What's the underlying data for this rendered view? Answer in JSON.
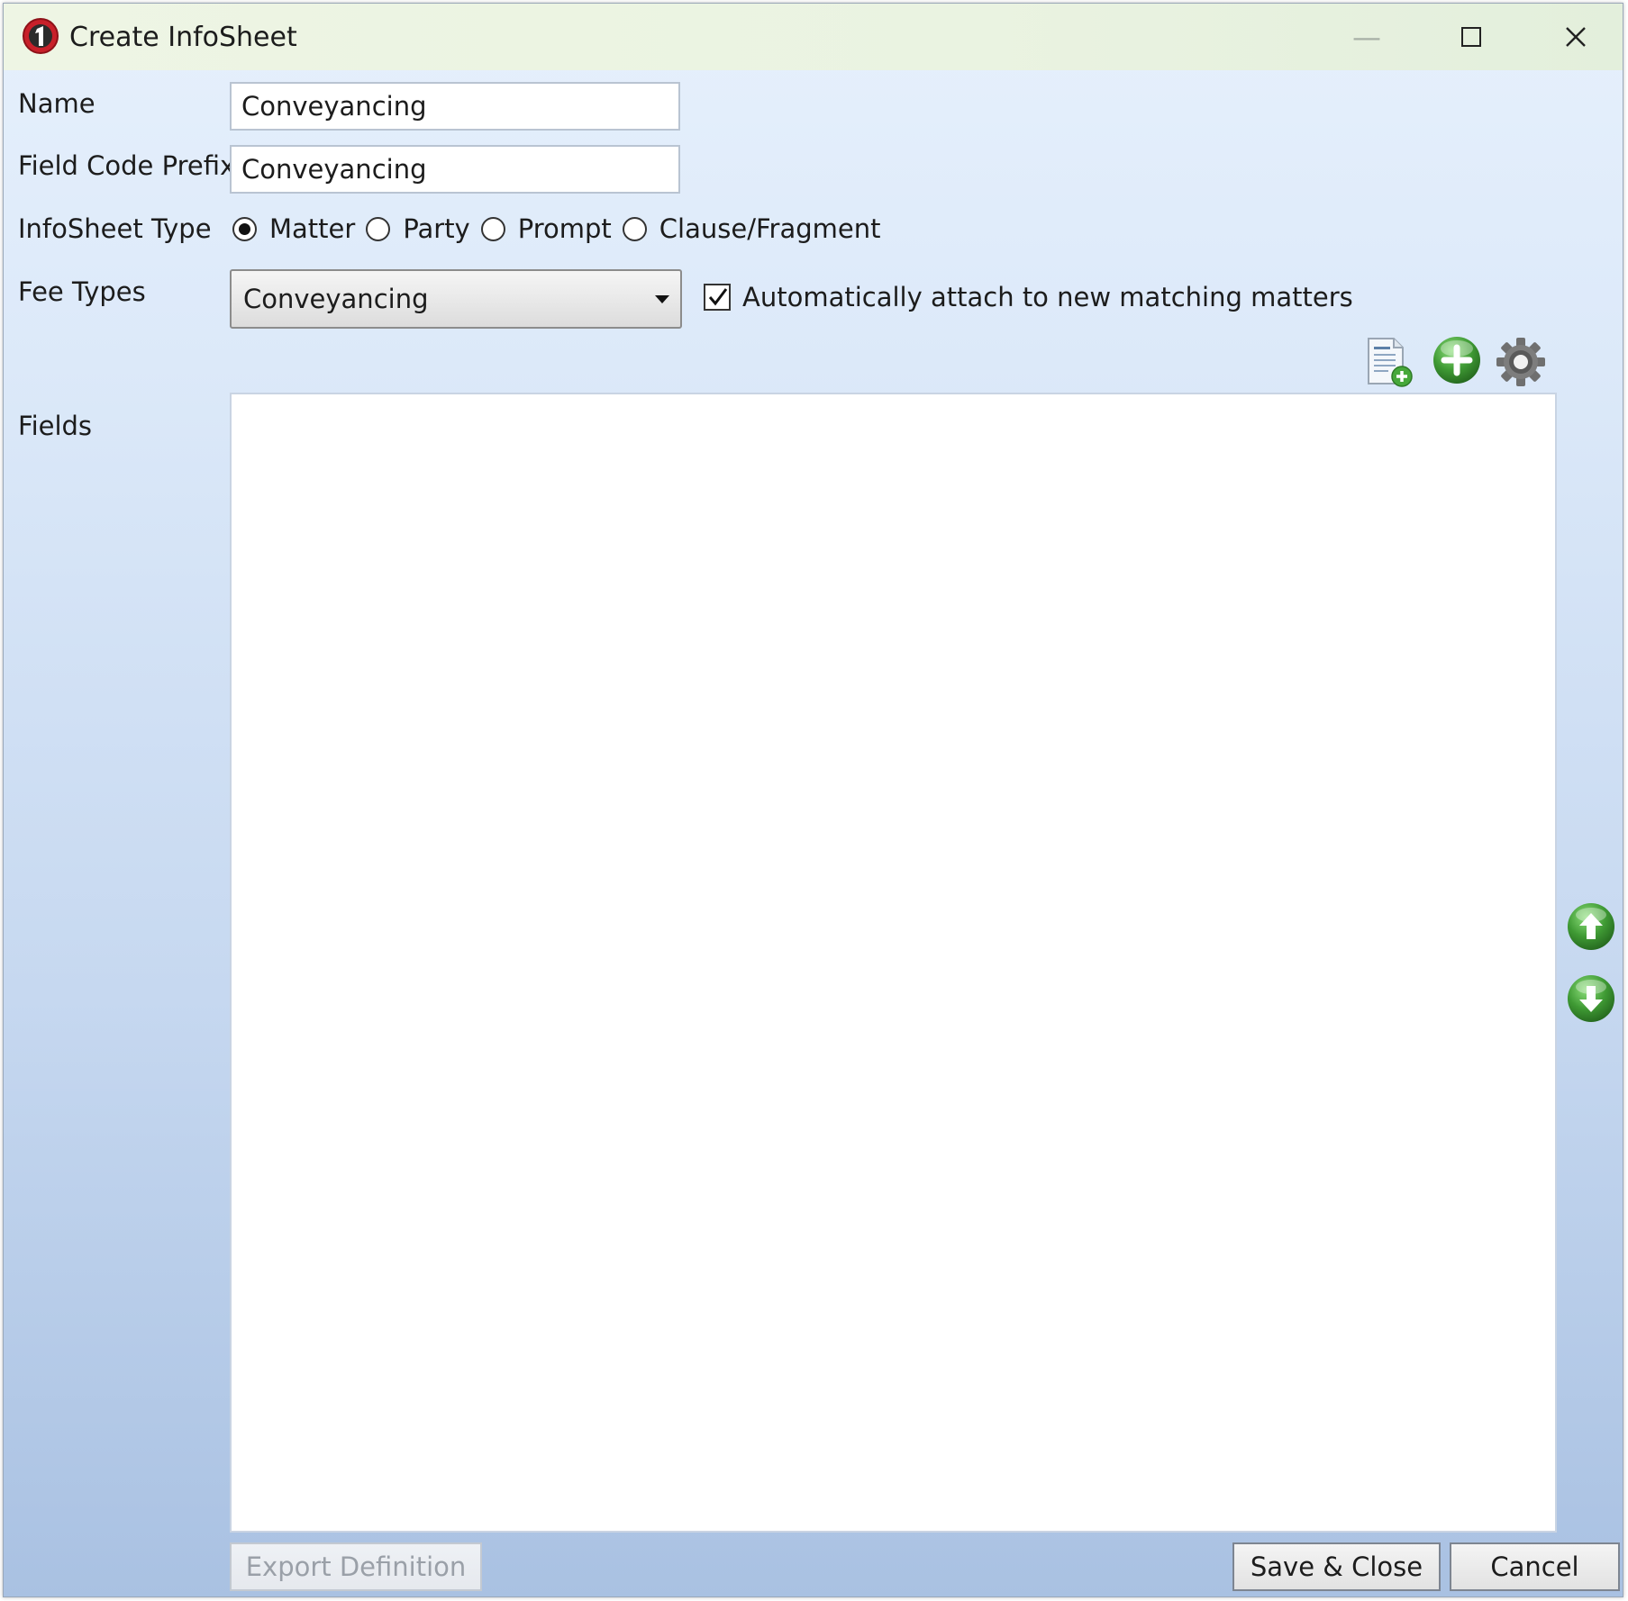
{
  "window": {
    "title": "Create InfoSheet",
    "icon": "app-logo-icon",
    "controls": {
      "minimize": "—",
      "maximize": "☐",
      "close": "✕"
    }
  },
  "form": {
    "name": {
      "label": "Name",
      "value": "Conveyancing"
    },
    "field_code_prefix": {
      "label": "Field Code Prefix",
      "value": "Conveyancing"
    },
    "infosheet_type": {
      "label": "InfoSheet Type",
      "options": [
        {
          "label": "Matter",
          "selected": true
        },
        {
          "label": "Party",
          "selected": false
        },
        {
          "label": "Prompt",
          "selected": false
        },
        {
          "label": "Clause/Fragment",
          "selected": false
        }
      ]
    },
    "fee_types": {
      "label": "Fee Types",
      "selected": "Conveyancing",
      "auto_attach_label": "Automatically attach to new matching matters",
      "auto_attach_checked": true
    },
    "fields": {
      "label": "Fields",
      "items": []
    }
  },
  "toolbar": {
    "icons": [
      "add-document-icon",
      "add-icon",
      "settings-gear-icon"
    ],
    "side_icons": [
      "move-up-icon",
      "move-down-icon"
    ]
  },
  "footer": {
    "export_label": "Export Definition",
    "save_label": "Save & Close",
    "cancel_label": "Cancel"
  },
  "colors": {
    "accent_green": "#3f9a34",
    "title_bar": "#eef5e4",
    "logo_red": "#c8202a"
  }
}
